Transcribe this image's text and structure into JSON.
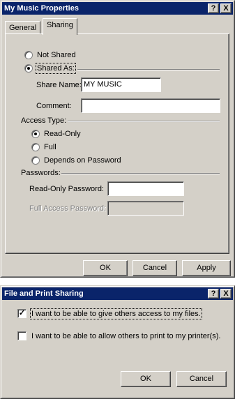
{
  "props": {
    "title": "My Music Properties",
    "titlebar_buttons": {
      "help": "?",
      "close": "X"
    },
    "tabs": [
      "General",
      "Sharing"
    ],
    "not_shared_label": "Not Shared",
    "shared_as_label": "Shared As:",
    "share_name_label": "Share Name:",
    "share_name_value": "MY MUSIC",
    "comment_label": "Comment:",
    "comment_value": "",
    "access_type_label": "Access Type:",
    "read_only_label": "Read-Only",
    "full_label": "Full",
    "depends_label": "Depends on Password",
    "passwords_label": "Passwords:",
    "read_only_password_label": "Read-Only Password:",
    "full_access_password_label": "Full Access Password:",
    "ok": "OK",
    "cancel": "Cancel",
    "apply": "Apply"
  },
  "fps": {
    "title": "File and Print Sharing",
    "titlebar_buttons": {
      "help": "?",
      "close": "X"
    },
    "files_option": "I want to be able to give others access to my files.",
    "files_checked": true,
    "printer_option": "I want to be able to allow others to print to my printer(s).",
    "printer_checked": false,
    "ok": "OK",
    "cancel": "Cancel"
  }
}
